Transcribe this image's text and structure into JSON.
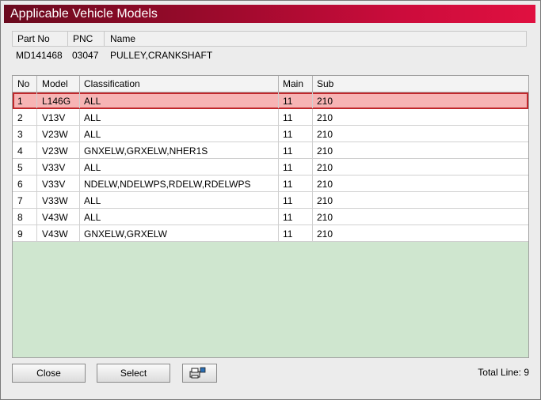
{
  "window": {
    "title": "Applicable Vehicle Models"
  },
  "info": {
    "headers": {
      "part_no": "Part No",
      "pnc": "PNC",
      "name": "Name"
    },
    "values": {
      "part_no": "MD141468",
      "pnc": "03047",
      "name": "PULLEY,CRANKSHAFT"
    }
  },
  "table": {
    "columns": {
      "no": "No",
      "model": "Model",
      "classification": "Classification",
      "main": "Main",
      "sub": "Sub"
    },
    "rows": [
      {
        "no": "1",
        "model": "L146G",
        "classification": "ALL",
        "main": "11",
        "sub": "210"
      },
      {
        "no": "2",
        "model": "V13V",
        "classification": "ALL",
        "main": "11",
        "sub": "210"
      },
      {
        "no": "3",
        "model": "V23W",
        "classification": "ALL",
        "main": "11",
        "sub": "210"
      },
      {
        "no": "4",
        "model": "V23W",
        "classification": "GNXELW,GRXELW,NHER1S",
        "main": "11",
        "sub": "210"
      },
      {
        "no": "5",
        "model": "V33V",
        "classification": "ALL",
        "main": "11",
        "sub": "210"
      },
      {
        "no": "6",
        "model": "V33V",
        "classification": "NDELW,NDELWPS,RDELW,RDELWPS",
        "main": "11",
        "sub": "210"
      },
      {
        "no": "7",
        "model": "V33W",
        "classification": "ALL",
        "main": "11",
        "sub": "210"
      },
      {
        "no": "8",
        "model": "V43W",
        "classification": "ALL",
        "main": "11",
        "sub": "210"
      },
      {
        "no": "9",
        "model": "V43W",
        "classification": "GNXELW,GRXELW",
        "main": "11",
        "sub": "210"
      }
    ],
    "selected_row": 0
  },
  "buttons": {
    "close": "Close",
    "select": "Select",
    "print_icon": "printer-icon"
  },
  "footer": {
    "total": "Total Line: 9"
  },
  "colors": {
    "title_start": "#6a0a1e",
    "title_end": "#e01040",
    "selected_bg": "#f7b4b4",
    "selected_border": "#c0282c",
    "empty_area": "#cfe6cf"
  }
}
